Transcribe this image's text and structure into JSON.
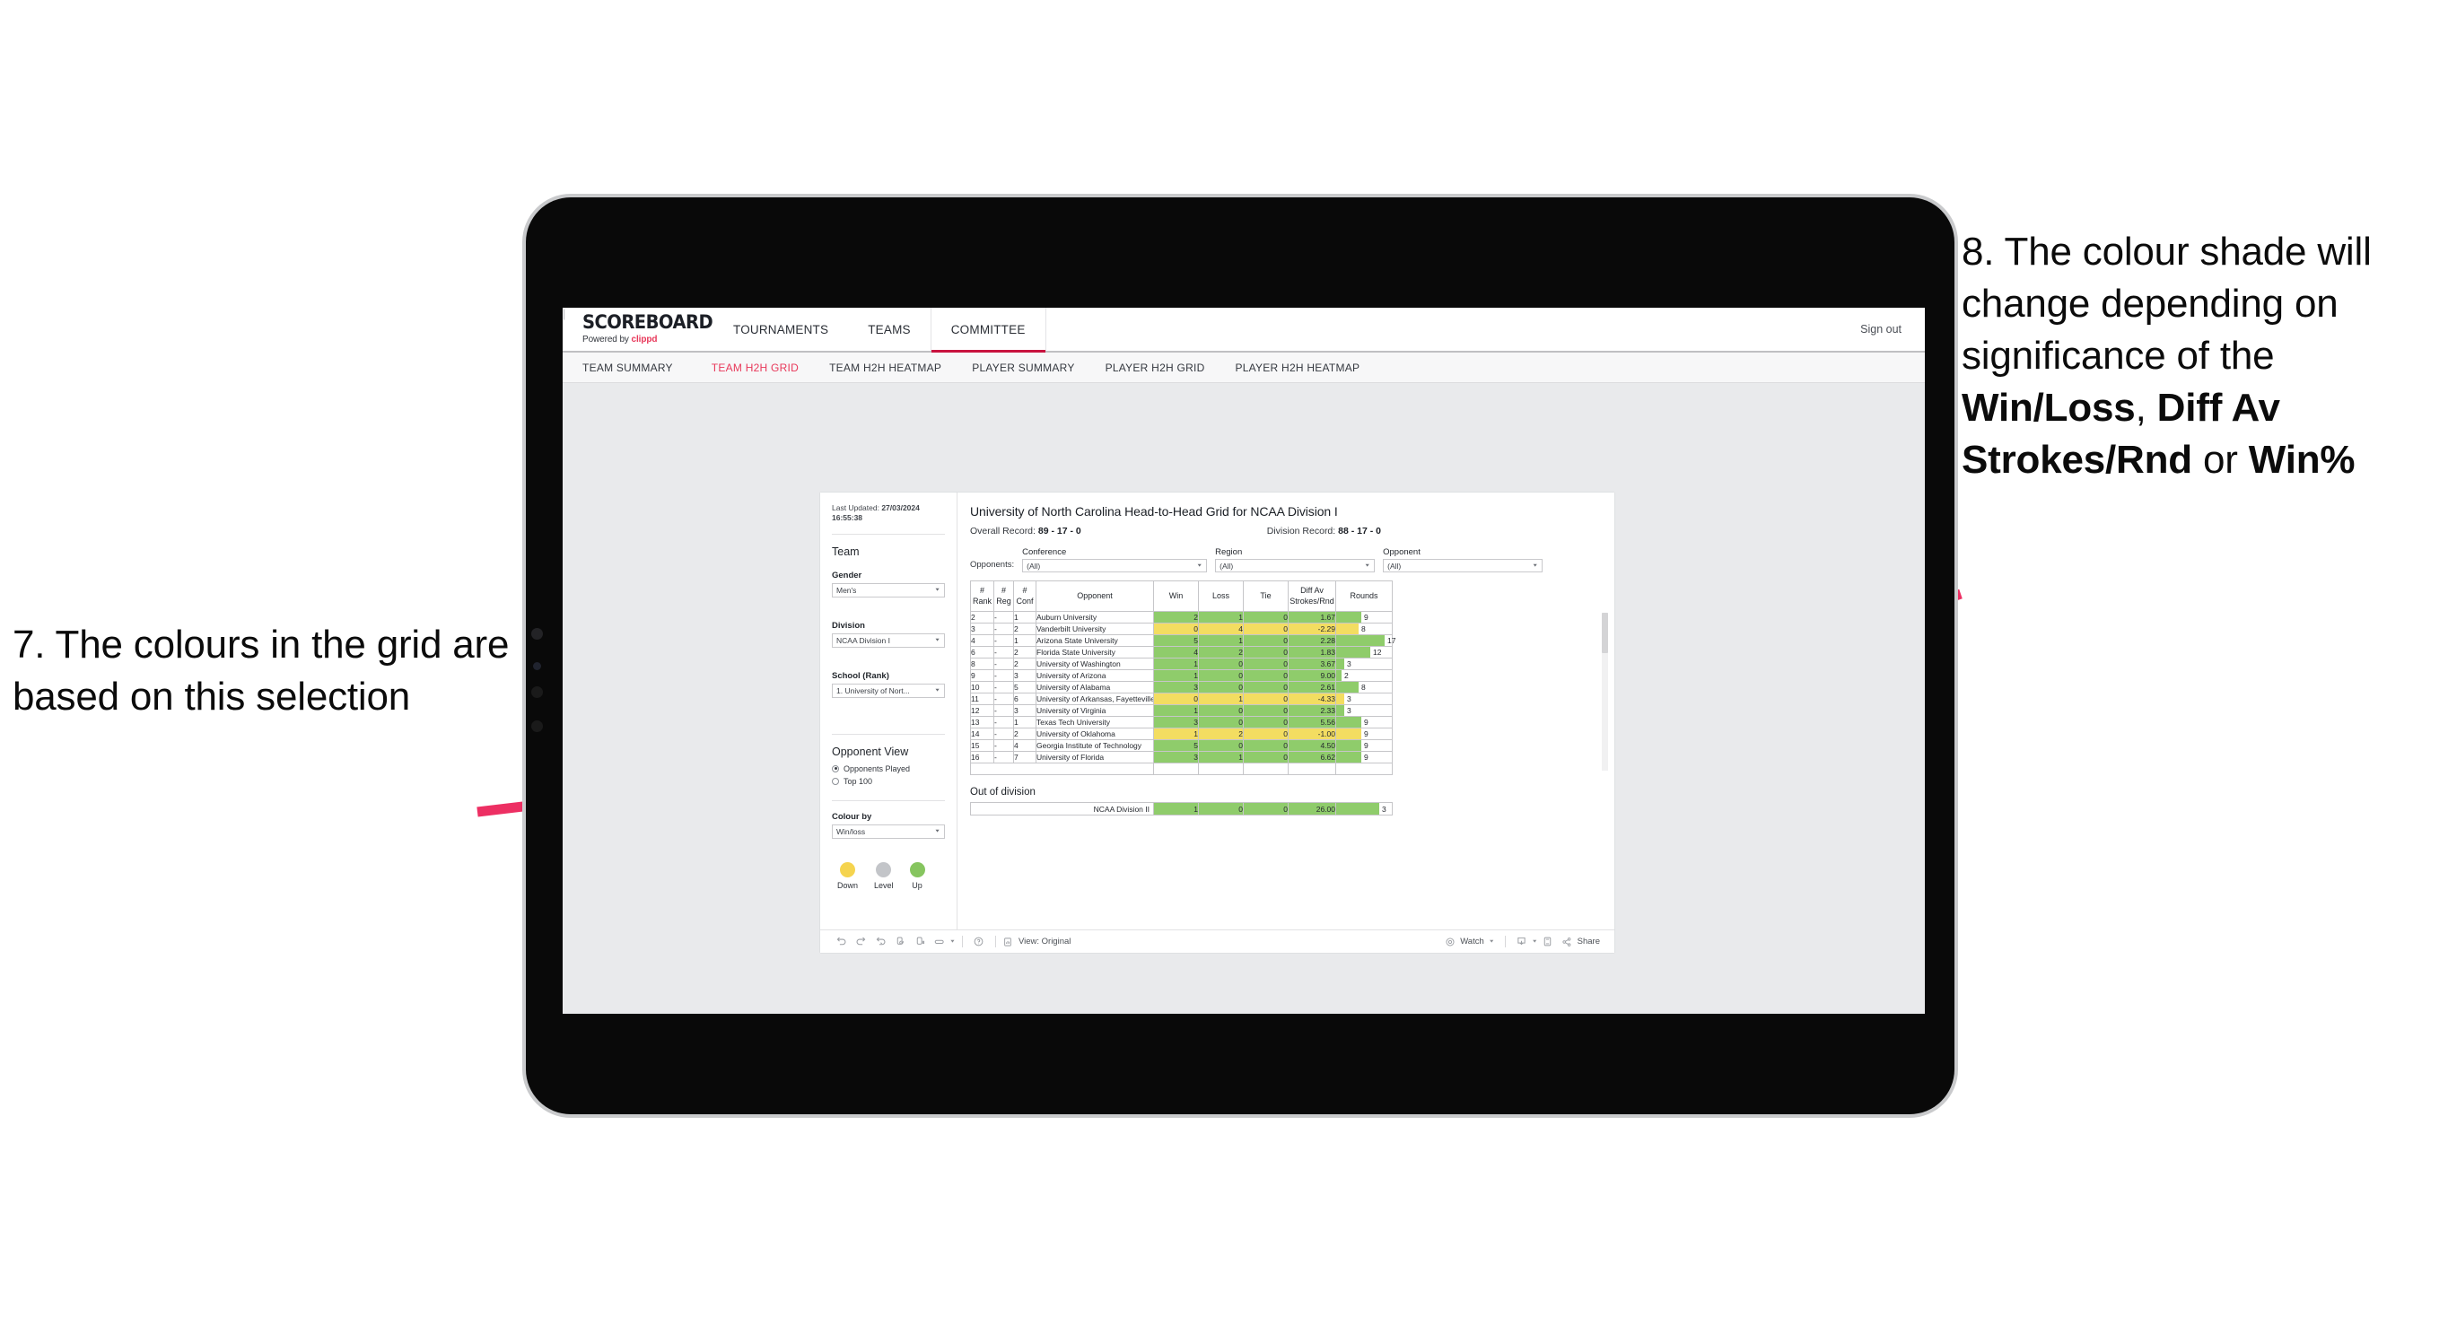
{
  "annotations": {
    "left": {
      "number": "7.",
      "text": "7. The colours in the grid are based on this selection"
    },
    "right": {
      "plain_1": "8. The colour shade will change depending on significance of the ",
      "bold_1": "Win/Loss",
      "plain_2": ", ",
      "bold_2": "Diff Av Strokes/Rnd",
      "plain_3": " or ",
      "bold_3": "Win%"
    },
    "arrow_color": "#ED2F63"
  },
  "app": {
    "brand": {
      "logo": "SCOREBOARD",
      "powered_by": "Powered by",
      "partner": "clippd"
    },
    "topnav": [
      {
        "label": "TOURNAMENTS",
        "active": false
      },
      {
        "label": "TEAMS",
        "active": false
      },
      {
        "label": "COMMITTEE",
        "active": true
      }
    ],
    "signout_label": "Sign out",
    "subnav": [
      {
        "label": "TEAM SUMMARY",
        "active": false
      },
      {
        "label": "TEAM H2H GRID",
        "active": true
      },
      {
        "label": "TEAM H2H HEATMAP",
        "active": false
      },
      {
        "label": "PLAYER SUMMARY",
        "active": false
      },
      {
        "label": "PLAYER H2H GRID",
        "active": false
      },
      {
        "label": "PLAYER H2H HEATMAP",
        "active": false
      }
    ],
    "accent_pink": "#E8385A",
    "accent_underline": "#C8133F"
  },
  "sidebar": {
    "last_updated_label": "Last Updated:",
    "last_updated_value": "27/03/2024 16:55:38",
    "team_heading": "Team",
    "gender_label": "Gender",
    "gender_value": "Men's",
    "division_label": "Division",
    "division_value": "NCAA Division I",
    "school_label": "School (Rank)",
    "school_value": "1. University of Nort...",
    "opponent_view_heading": "Opponent View",
    "opponent_view_options": [
      {
        "label": "Opponents Played",
        "selected": true
      },
      {
        "label": "Top 100",
        "selected": false
      }
    ],
    "colour_by_label": "Colour by",
    "colour_by_value": "Win/loss",
    "legend": [
      {
        "label": "Down",
        "color": "#F5D44F"
      },
      {
        "label": "Level",
        "color": "#C3C5C9"
      },
      {
        "label": "Up",
        "color": "#86C55F"
      }
    ]
  },
  "report": {
    "title": "University of North Carolina Head-to-Head Grid for NCAA Division I",
    "overall_record_label": "Overall Record:",
    "overall_record_value": "89 - 17 - 0",
    "division_record_label": "Division Record:",
    "division_record_value": "88 - 17 - 0",
    "opponents_label": "Opponents:",
    "filters": [
      {
        "caption": "Conference",
        "value": "(All)"
      },
      {
        "caption": "Region",
        "value": "(All)"
      },
      {
        "caption": "Opponent",
        "value": "(All)"
      }
    ],
    "out_of_division_heading": "Out of division",
    "out_of_division_row": {
      "label": "NCAA Division II",
      "win": "1",
      "loss": "0",
      "tie": "0",
      "diff": "26.00",
      "rounds": "3",
      "color": "green"
    }
  },
  "chart_data": {
    "type": "table",
    "title": "University of North Carolina Head-to-Head Grid for NCAA Division I",
    "columns": [
      "# Rank",
      "# Reg",
      "# Conf",
      "Opponent",
      "Win",
      "Loss",
      "Tie",
      "Diff Av Strokes/Rnd",
      "Rounds"
    ],
    "rounds_max": 20,
    "colors": {
      "up": "#8FCC6B",
      "down": "#F3DD61",
      "level": "#C3C5C9"
    },
    "rows": [
      {
        "rank": "2",
        "reg": "-",
        "conf": "1",
        "opponent": "Auburn University",
        "win": "2",
        "loss": "1",
        "tie": "0",
        "diff": "1.67",
        "rounds": "9",
        "color": "green"
      },
      {
        "rank": "3",
        "reg": "-",
        "conf": "2",
        "opponent": "Vanderbilt University",
        "win": "0",
        "loss": "4",
        "tie": "0",
        "diff": "-2.29",
        "rounds": "8",
        "color": "yellow"
      },
      {
        "rank": "4",
        "reg": "-",
        "conf": "1",
        "opponent": "Arizona State University",
        "win": "5",
        "loss": "1",
        "tie": "0",
        "diff": "2.28",
        "rounds": "17",
        "color": "green"
      },
      {
        "rank": "6",
        "reg": "-",
        "conf": "2",
        "opponent": "Florida State University",
        "win": "4",
        "loss": "2",
        "tie": "0",
        "diff": "1.83",
        "rounds": "12",
        "color": "green"
      },
      {
        "rank": "8",
        "reg": "-",
        "conf": "2",
        "opponent": "University of Washington",
        "win": "1",
        "loss": "0",
        "tie": "0",
        "diff": "3.67",
        "rounds": "3",
        "color": "green"
      },
      {
        "rank": "9",
        "reg": "-",
        "conf": "3",
        "opponent": "University of Arizona",
        "win": "1",
        "loss": "0",
        "tie": "0",
        "diff": "9.00",
        "rounds": "2",
        "color": "green"
      },
      {
        "rank": "10",
        "reg": "-",
        "conf": "5",
        "opponent": "University of Alabama",
        "win": "3",
        "loss": "0",
        "tie": "0",
        "diff": "2.61",
        "rounds": "8",
        "color": "green"
      },
      {
        "rank": "11",
        "reg": "-",
        "conf": "6",
        "opponent": "University of Arkansas, Fayetteville",
        "win": "0",
        "loss": "1",
        "tie": "0",
        "diff": "-4.33",
        "rounds": "3",
        "color": "yellow"
      },
      {
        "rank": "12",
        "reg": "-",
        "conf": "3",
        "opponent": "University of Virginia",
        "win": "1",
        "loss": "0",
        "tie": "0",
        "diff": "2.33",
        "rounds": "3",
        "color": "green"
      },
      {
        "rank": "13",
        "reg": "-",
        "conf": "1",
        "opponent": "Texas Tech University",
        "win": "3",
        "loss": "0",
        "tie": "0",
        "diff": "5.56",
        "rounds": "9",
        "color": "green"
      },
      {
        "rank": "14",
        "reg": "-",
        "conf": "2",
        "opponent": "University of Oklahoma",
        "win": "1",
        "loss": "2",
        "tie": "0",
        "diff": "-1.00",
        "rounds": "9",
        "color": "yellow"
      },
      {
        "rank": "15",
        "reg": "-",
        "conf": "4",
        "opponent": "Georgia Institute of Technology",
        "win": "5",
        "loss": "0",
        "tie": "0",
        "diff": "4.50",
        "rounds": "9",
        "color": "green"
      },
      {
        "rank": "16",
        "reg": "-",
        "conf": "7",
        "opponent": "University of Florida",
        "win": "3",
        "loss": "1",
        "tie": "0",
        "diff": "6.62",
        "rounds": "9",
        "color": "green"
      }
    ]
  },
  "toolbar": {
    "view_label": "View: Original",
    "watch_label": "Watch",
    "share_label": "Share"
  }
}
